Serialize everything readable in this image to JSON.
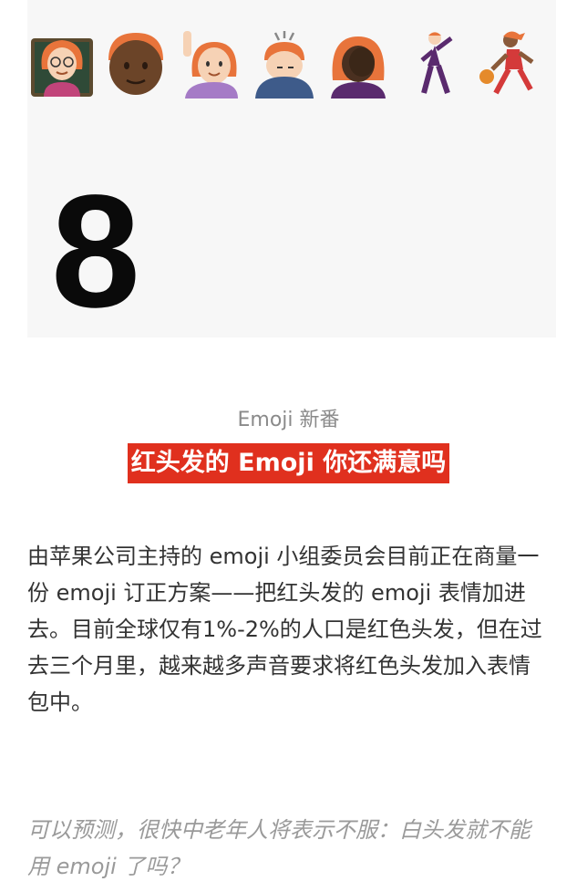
{
  "hero": {
    "number": "8",
    "emojis": [
      {
        "name": "red-hair-teacher-emoji"
      },
      {
        "name": "red-hair-dark-skin-man-emoji"
      },
      {
        "name": "red-hair-woman-raising-hand-emoji"
      },
      {
        "name": "red-hair-man-bowing-emoji"
      },
      {
        "name": "red-hair-woman-facepalm-emoji"
      },
      {
        "name": "man-dancing-emoji"
      },
      {
        "name": "woman-basketball-emoji"
      }
    ]
  },
  "article": {
    "kicker": "Emoji 新番",
    "headline": "红头发的 Emoji 你还满意吗",
    "body": "由苹果公司主持的 emoji 小组委员会目前正在商量一份 emoji 订正方案——把红头发的 emoji 表情加进去。目前全球仅有1%-2%的人口是红色头发，但在过去三个月里，越来越多声音要求将红色头发加入表情包中。",
    "closing": "可以预测，很快中老年人将表示不服：白头发就不能用 emoji 了吗？"
  },
  "colors": {
    "headline_bg": "#e0301e",
    "hero_bg": "#f7f7f7",
    "hair": "#e8743b"
  }
}
